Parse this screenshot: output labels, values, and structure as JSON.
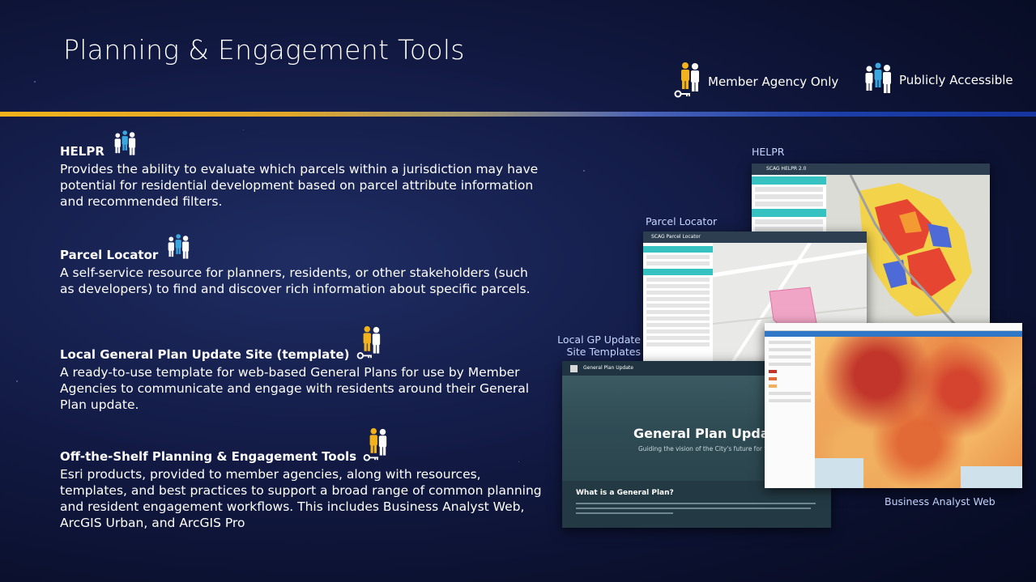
{
  "slide": {
    "title": "Planning & Engagement Tools",
    "legend": {
      "member_label": "Member Agency Only",
      "public_label": "Publicly Accessible"
    },
    "colors": {
      "member_icon": "#f2b21c",
      "public_icon": "#3aa7e0",
      "person": "#ffffff",
      "divider_left": "#f2b21c",
      "divider_right": "#1536a0"
    }
  },
  "sections": [
    {
      "title": "HELPR",
      "access": "public",
      "body": "Provides the ability to evaluate which parcels within a jurisdiction may have potential for residential development based on parcel attribute information and recommended filters."
    },
    {
      "title": "Parcel Locator",
      "access": "public",
      "body": "A self-service resource for planners, residents, or other stakeholders (such as developers) to find and discover rich information about specific parcels."
    },
    {
      "title": "Local General Plan Update Site (template)",
      "access": "member",
      "body": "A ready-to-use template for web-based General Plans for use by Member Agencies to communicate and engage with residents around their General Plan update."
    },
    {
      "title": "Off-the-Shelf Planning & Engagement Tools",
      "access": "member",
      "body": "Esri products, provided to member agencies, along with resources, templates, and best practices to support a broad range of common planning and resident engagement workflows. This includes Business Analyst Web, ArcGIS Urban, and ArcGIS Pro"
    }
  ],
  "screenshots": {
    "helpr_label": "HELPR",
    "parcel_label": "Parcel Locator",
    "gp_label_line1": "Local GP Update",
    "gp_label_line2": "Site Templates",
    "ba_label": "Business Analyst Web",
    "helpr_bar": "SCAG  HELPR 2.0",
    "parcel_bar": "SCAG  Parcel Locator",
    "gp_header": "General Plan Update",
    "gp_hero_title": "General Plan Update",
    "gp_hero_sub": "Guiding the vision of the City's future for the year 20",
    "gp_question": "What is a General Plan?"
  }
}
